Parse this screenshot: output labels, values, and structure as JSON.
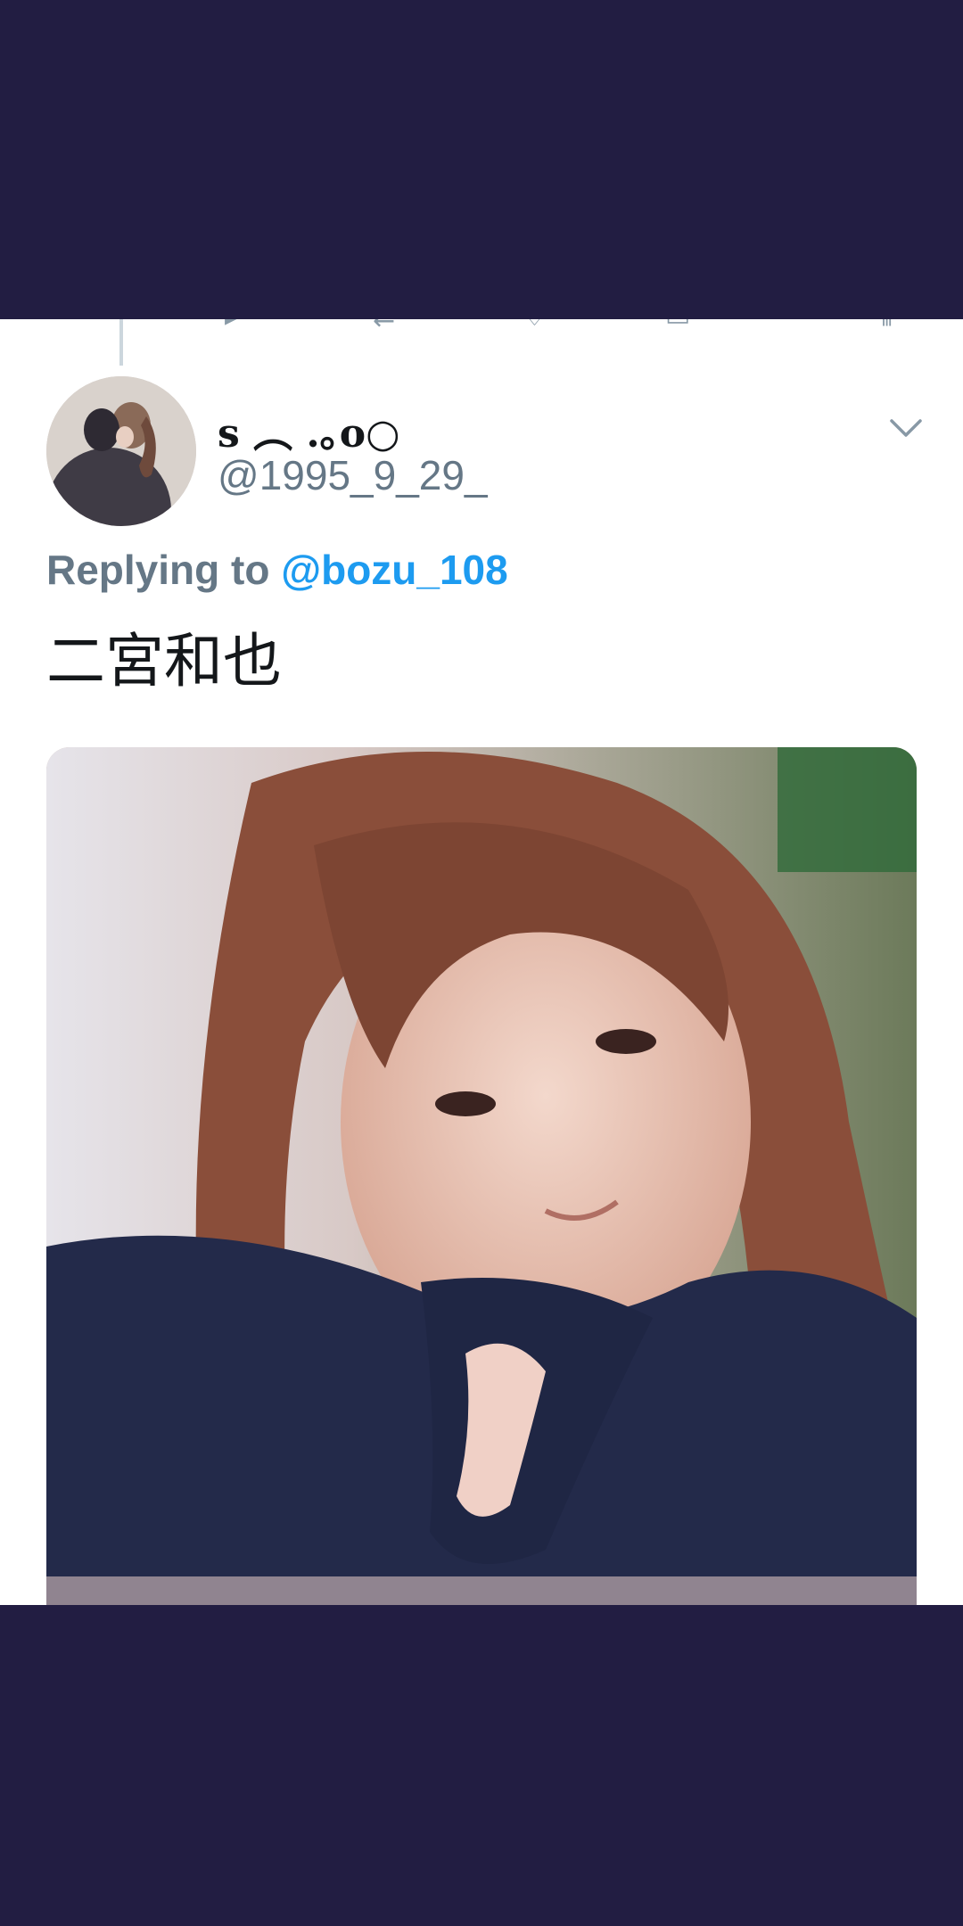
{
  "tweet": {
    "display_name": "s ︵ .｡o○",
    "handle": "@1995_9_29_",
    "replying_prefix": "Replying to",
    "replying_to": "@bozu_108",
    "text": "二宮和也"
  },
  "icons": {
    "more_options": "chevron-down-icon",
    "prev_actions": [
      "reply-icon",
      "retweet-icon",
      "like-icon",
      "share-icon",
      "stats-icon"
    ]
  },
  "colors": {
    "backdrop": "#221d42",
    "link": "#1d9bf0",
    "secondary_text": "#657786"
  }
}
